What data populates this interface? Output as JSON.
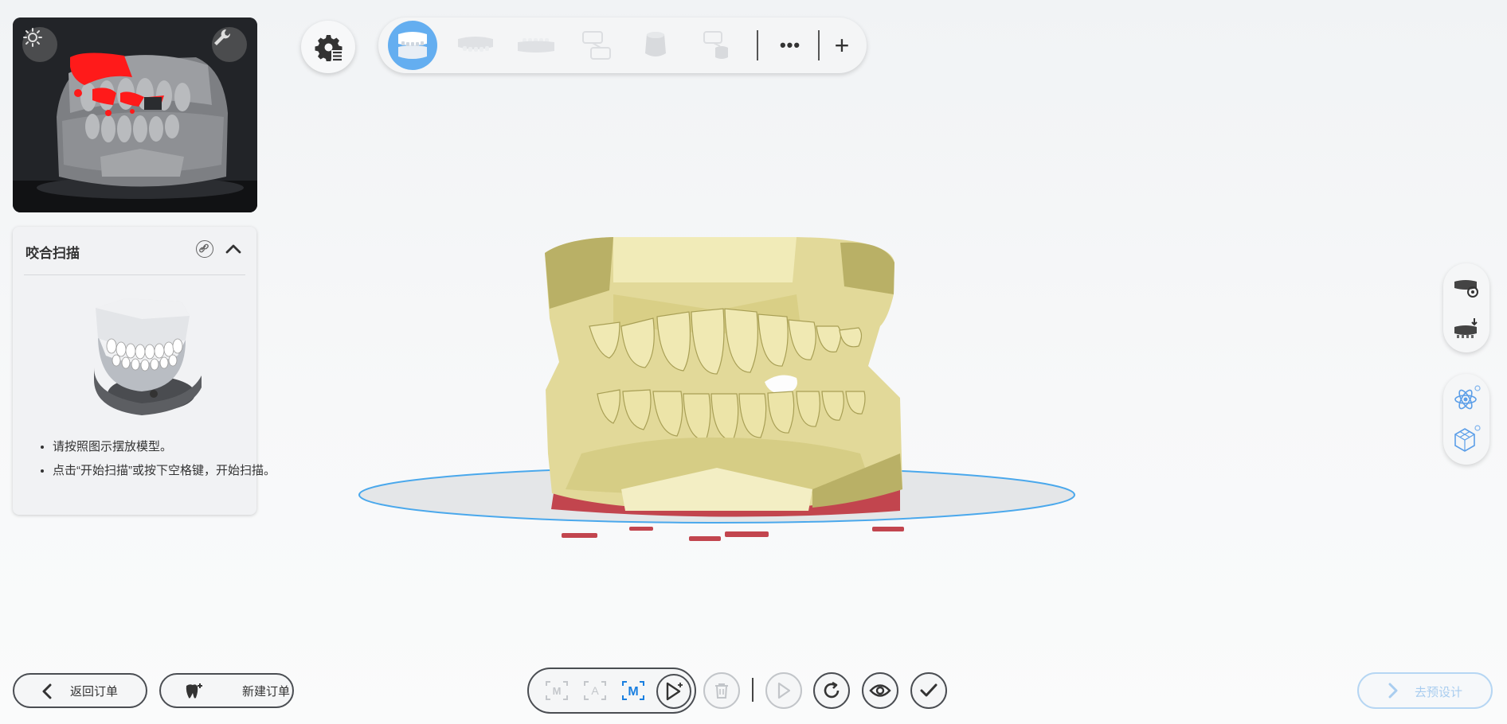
{
  "camera": {
    "buttons": [
      "brightness-icon",
      "wrench-icon"
    ]
  },
  "guide": {
    "title": "咬合扫描",
    "instructions": [
      "请按照图示摆放模型。",
      "点击“开始扫描”或按下空格键，开始扫描。"
    ]
  },
  "toolbar": {
    "steps": [
      "upper-lower-jaw-step",
      "upper-jaw-step",
      "lower-jaw-step",
      "bite-scan-step",
      "abutment-step",
      "post-scan-step"
    ],
    "more_label": "•••",
    "add_label": "+"
  },
  "bottom": {
    "back_label": "返回订单",
    "new_order_label": "新建订单",
    "next_label": "去预设计",
    "scan_modes": [
      "M",
      "A",
      "M"
    ]
  },
  "colors": {
    "accent": "#64aef0",
    "model": "#e4dc9a",
    "model_shadow": "#b5ac62",
    "base_red": "#c2454e",
    "platform_ring": "#4aa8ec"
  }
}
